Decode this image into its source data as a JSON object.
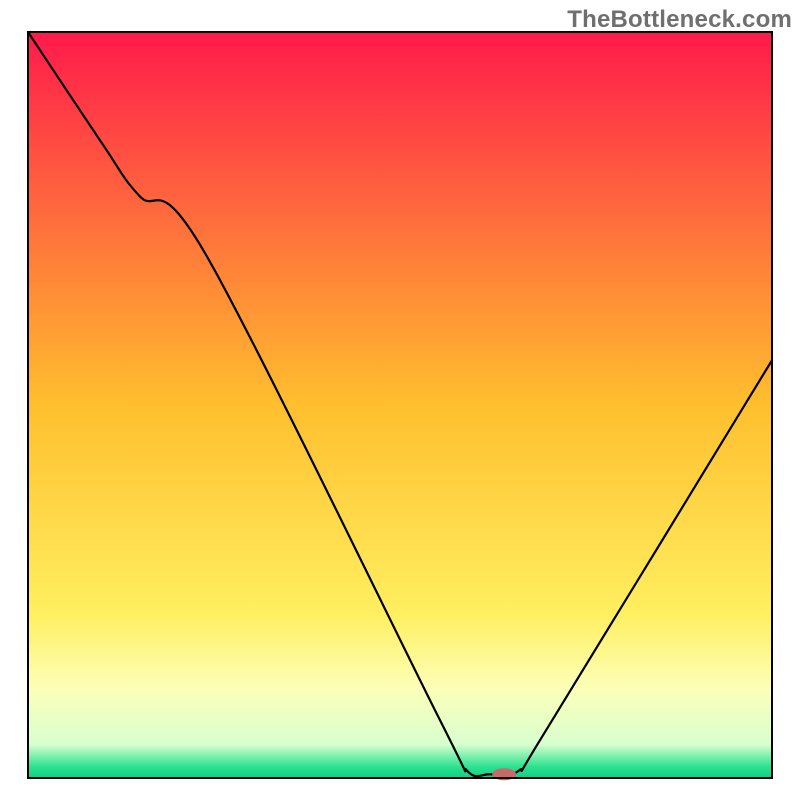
{
  "watermark": "TheBottleneck.com",
  "chart_data": {
    "type": "line",
    "title": "",
    "xlabel": "",
    "ylabel": "",
    "xlim": [
      0,
      100
    ],
    "ylim": [
      0,
      100
    ],
    "grid": false,
    "legend": false,
    "annotations": [],
    "background_gradient": {
      "stops": [
        {
          "offset": 0.0,
          "color": "#ff1a4b"
        },
        {
          "offset": 0.5,
          "color": "#ffbf2e"
        },
        {
          "offset": 0.78,
          "color": "#ffef60"
        },
        {
          "offset": 0.88,
          "color": "#fdffb8"
        },
        {
          "offset": 0.955,
          "color": "#d8ffcf"
        },
        {
          "offset": 0.985,
          "color": "#2be28f"
        },
        {
          "offset": 1.0,
          "color": "#0fd084"
        }
      ]
    },
    "series": [
      {
        "name": "bottleneck-curve",
        "stroke": "#000000",
        "x": [
          0,
          10,
          15,
          24,
          55,
          59,
          62,
          66,
          70,
          100
        ],
        "values": [
          100,
          85,
          78,
          70,
          8.5,
          1.0,
          0.5,
          1.0,
          7.0,
          56
        ]
      }
    ],
    "marker": {
      "name": "optimal-point",
      "x": 64,
      "y": 0.5,
      "color": "#c76a6a",
      "rx": 12,
      "ry": 6
    },
    "baseline": {
      "y": 0,
      "color": "#000000",
      "width": 2
    }
  }
}
